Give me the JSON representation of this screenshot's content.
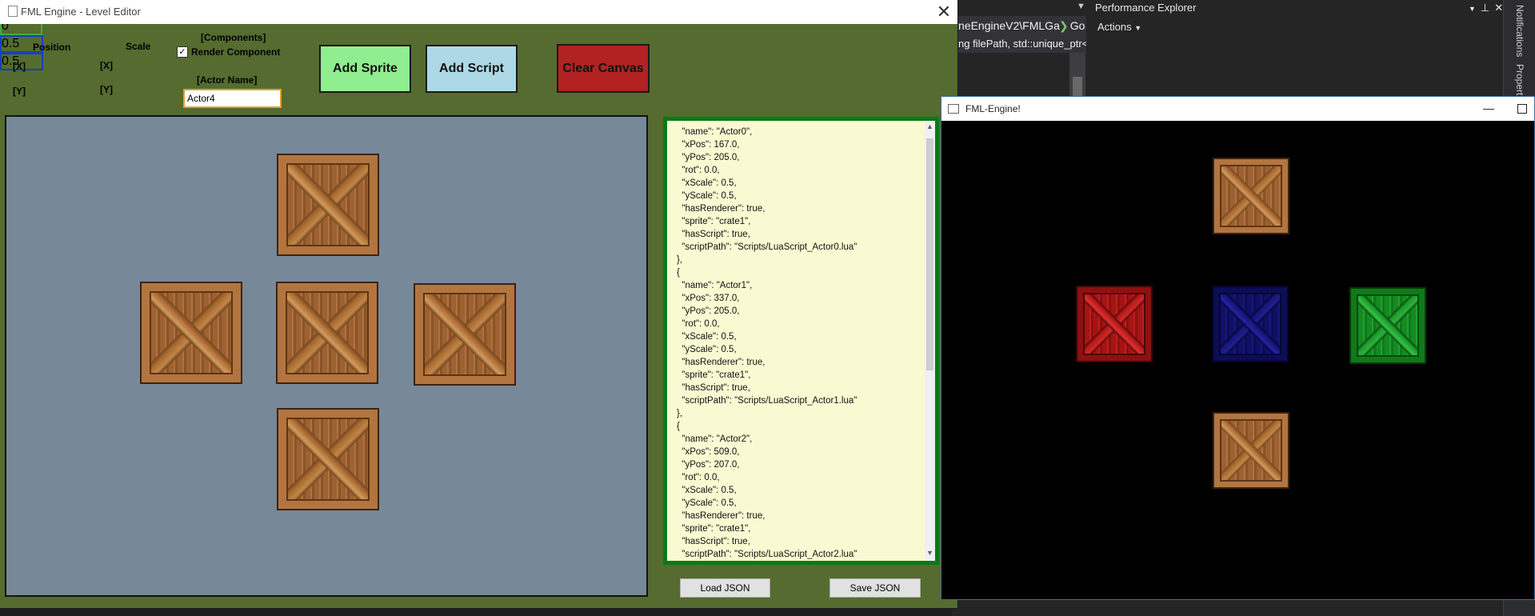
{
  "ide": {
    "path_text": "neEngineV2\\FMLGa",
    "go_label": "Go",
    "combo_text": "ng filePath, std::unique_ptr<",
    "panel_title": "Performance Explorer",
    "actions_label": "Actions",
    "side_tabs": [
      "Notifications",
      "Propert"
    ]
  },
  "editor": {
    "title": "FML Engine - Level Editor",
    "close_glyph": "✕",
    "position_label": "Position",
    "scale_label": "Scale",
    "x_tag": "[X]",
    "y_tag": "[Y]",
    "components_label": "[Components]",
    "render_component_label": "Render Component",
    "render_component_checked": true,
    "actor_name_label": "[Actor Name]",
    "position_x": "0",
    "position_y": "0",
    "scale_x": "0.5",
    "scale_y": "0.5",
    "actor_name": "Actor4",
    "add_sprite_label": "Add Sprite",
    "add_script_label": "Add Script",
    "clear_canvas_label": "Clear Canvas",
    "load_json_label": "Load JSON",
    "save_json_label": "Save JSON",
    "json_text": "  \"name\": \"Actor0\",\n  \"xPos\": 167.0,\n  \"yPos\": 205.0,\n  \"rot\": 0.0,\n  \"xScale\": 0.5,\n  \"yScale\": 0.5,\n  \"hasRenderer\": true,\n  \"sprite\": \"crate1\",\n  \"hasScript\": true,\n  \"scriptPath\": \"Scripts/LuaScript_Actor0.lua\"\n},\n{\n  \"name\": \"Actor1\",\n  \"xPos\": 337.0,\n  \"yPos\": 205.0,\n  \"rot\": 0.0,\n  \"xScale\": 0.5,\n  \"yScale\": 0.5,\n  \"hasRenderer\": true,\n  \"sprite\": \"crate1\",\n  \"hasScript\": true,\n  \"scriptPath\": \"Scripts/LuaScript_Actor1.lua\"\n},\n{\n  \"name\": \"Actor2\",\n  \"xPos\": 509.0,\n  \"yPos\": 207.0,\n  \"rot\": 0.0,\n  \"xScale\": 0.5,\n  \"yScale\": 0.5,\n  \"hasRenderer\": true,\n  \"sprite\": \"crate1\",\n  \"hasScript\": true,\n  \"scriptPath\": \"Scripts/LuaScript_Actor2.lua\"\n}"
  },
  "game": {
    "title": "FML-Engine!",
    "minimize_glyph": "—"
  },
  "colors": {
    "editor_bg": "#556b2f",
    "canvas_bg": "#778899",
    "json_bg": "#fafad2",
    "add_sprite": "#90ee90",
    "add_script": "#add8e6",
    "clear_canvas": "#b22222",
    "crate_red": "#8e1010",
    "crate_blue": "#0d0d55",
    "crate_green": "#0f7a1a"
  }
}
